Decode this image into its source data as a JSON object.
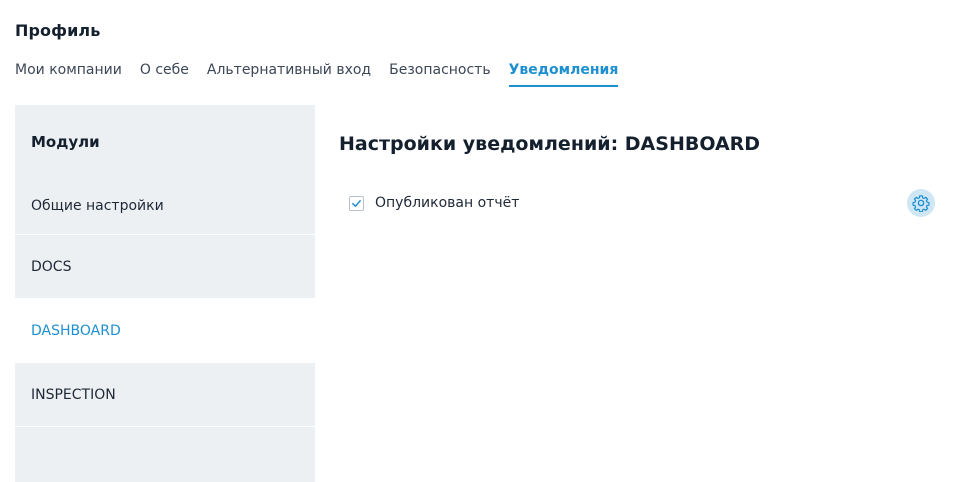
{
  "page": {
    "title": "Профиль"
  },
  "tabs": [
    {
      "label": "Мои компании"
    },
    {
      "label": "О себе"
    },
    {
      "label": "Альтернативный вход"
    },
    {
      "label": "Безопасность"
    },
    {
      "label": "Уведомления",
      "active": true
    }
  ],
  "sidebar": {
    "header": "Модули",
    "items": [
      {
        "label": "Общие настройки"
      },
      {
        "label": "DOCS"
      },
      {
        "label": "DASHBOARD",
        "active": true
      },
      {
        "label": "INSPECTION"
      }
    ]
  },
  "content": {
    "title": "Настройки уведомлений: DASHBOARD",
    "settings": [
      {
        "label": "Опубликован отчёт",
        "checked": true,
        "action_icon": "gear-icon"
      }
    ]
  },
  "colors": {
    "accent": "#1e8fd0",
    "sidebar_bg": "#edf0f3",
    "gear_bg": "#cfe6f4"
  }
}
